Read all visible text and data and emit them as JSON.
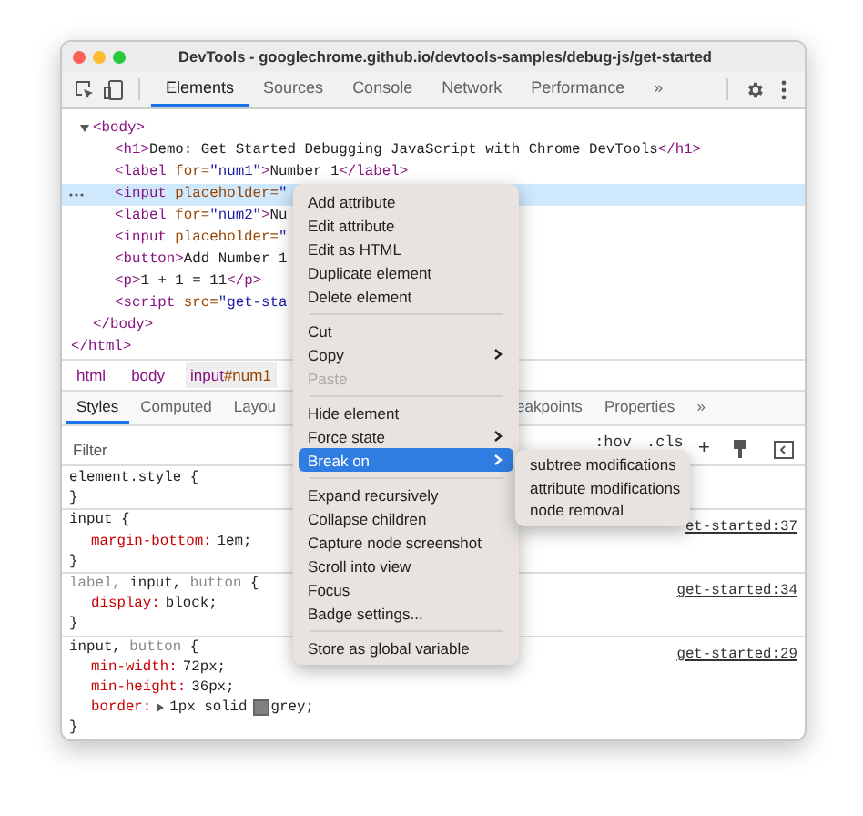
{
  "window": {
    "title": "DevTools - googlechrome.github.io/devtools-samples/debug-js/get-started"
  },
  "toolbar": {
    "tabs": [
      {
        "label": "Elements",
        "selected": true
      },
      {
        "label": "Sources",
        "selected": false
      },
      {
        "label": "Console",
        "selected": false
      },
      {
        "label": "Network",
        "selected": false
      },
      {
        "label": "Performance",
        "selected": false
      }
    ],
    "more": "»"
  },
  "dom": {
    "children": [
      {
        "text": "<body>",
        "expanded": true,
        "selected": false,
        "closing": "</body>",
        "children": [
          {
            "text": "<h1>Demo: Get Started Debugging JavaScript with Chrome DevTools</h1>",
            "selected": false
          },
          {
            "text": "<label for=\"num1\">Number 1</label>",
            "selected": false
          },
          {
            "text": "<input placeholder=\"",
            "selected": true
          },
          {
            "text": "<label for=\"num2\">Nu",
            "selected": false
          },
          {
            "text": "<input placeholder=\"",
            "selected": false
          },
          {
            "text": "<button>Add Number 1",
            "selected": false
          },
          {
            "text": "<p>1 + 1 = 11</p>",
            "selected": false
          },
          {
            "text": "<script src=\"get-sta",
            "selected": false
          }
        ]
      }
    ],
    "closing": "</html>"
  },
  "breadcrumbs": [
    {
      "tag": "html"
    },
    {
      "tag": "body"
    },
    {
      "tag": "input",
      "id": "#num1"
    }
  ],
  "style_tabs": {
    "tabs": [
      {
        "label": "Styles",
        "selected": true
      },
      {
        "label": "Computed",
        "selected": false
      },
      {
        "label": "Layou",
        "selected": false
      },
      {
        "label": "eakpoints",
        "selected": false
      },
      {
        "label": "Properties",
        "selected": false
      }
    ],
    "more": "»"
  },
  "filter": {
    "placeholder": "Filter",
    "hov": ":hov",
    "cls": ".cls",
    "add": "+"
  },
  "rules": [
    {
      "selector": [
        {
          "text": "element.style",
          "matched": true
        }
      ],
      "open": "{",
      "close": "}"
    },
    {
      "selector": [
        {
          "text": "input",
          "matched": true
        }
      ],
      "open": "{",
      "close": "}",
      "source": "et-started:37",
      "declarations": [
        {
          "property": "margin-bottom:",
          "value": "1em;"
        }
      ]
    },
    {
      "selector": [
        {
          "text": "label,",
          "matched": false
        },
        {
          "text": "input,",
          "matched": true
        },
        {
          "text": "button",
          "matched": false
        }
      ],
      "open": "{",
      "close": "}",
      "source": "get-started:34",
      "declarations": [
        {
          "property": "display:",
          "value": "block;"
        }
      ]
    },
    {
      "selector": [
        {
          "text": "input,",
          "matched": true
        },
        {
          "text": "button",
          "matched": false
        }
      ],
      "open": "{",
      "close": "}",
      "source": "get-started:29",
      "declarations": [
        {
          "property": "min-width:",
          "value": "72px;"
        },
        {
          "property": "min-height:",
          "value": "36px;"
        },
        {
          "property": "border:",
          "value": "1px solid",
          "expandable": true,
          "swatch_value": "grey;"
        }
      ]
    }
  ],
  "context_menu": {
    "groups": [
      [
        {
          "label": "Add attribute",
          "disabled": false,
          "submenu": false,
          "selected": false
        },
        {
          "label": "Edit attribute",
          "disabled": false,
          "submenu": false,
          "selected": false
        },
        {
          "label": "Edit as HTML",
          "disabled": false,
          "submenu": false,
          "selected": false
        },
        {
          "label": "Duplicate element",
          "disabled": false,
          "submenu": false,
          "selected": false
        },
        {
          "label": "Delete element",
          "disabled": false,
          "submenu": false,
          "selected": false
        }
      ],
      [
        {
          "label": "Cut",
          "disabled": false,
          "submenu": false,
          "selected": false
        },
        {
          "label": "Copy",
          "disabled": false,
          "submenu": true,
          "selected": false
        },
        {
          "label": "Paste",
          "disabled": true,
          "submenu": false,
          "selected": false
        }
      ],
      [
        {
          "label": "Hide element",
          "disabled": false,
          "submenu": false,
          "selected": false
        },
        {
          "label": "Force state",
          "disabled": false,
          "submenu": true,
          "selected": false
        },
        {
          "label": "Break on",
          "disabled": false,
          "submenu": true,
          "selected": true
        }
      ],
      [
        {
          "label": "Expand recursively",
          "disabled": false,
          "submenu": false,
          "selected": false
        },
        {
          "label": "Collapse children",
          "disabled": false,
          "submenu": false,
          "selected": false
        },
        {
          "label": "Capture node screenshot",
          "disabled": false,
          "submenu": false,
          "selected": false
        },
        {
          "label": "Scroll into view",
          "disabled": false,
          "submenu": false,
          "selected": false
        },
        {
          "label": "Focus",
          "disabled": false,
          "submenu": false,
          "selected": false
        },
        {
          "label": "Badge settings...",
          "disabled": false,
          "submenu": false,
          "selected": false
        }
      ],
      [
        {
          "label": "Store as global variable",
          "disabled": false,
          "submenu": false,
          "selected": false
        }
      ]
    ],
    "submenu": [
      "subtree modifications",
      "attribute modifications",
      "node removal"
    ]
  }
}
